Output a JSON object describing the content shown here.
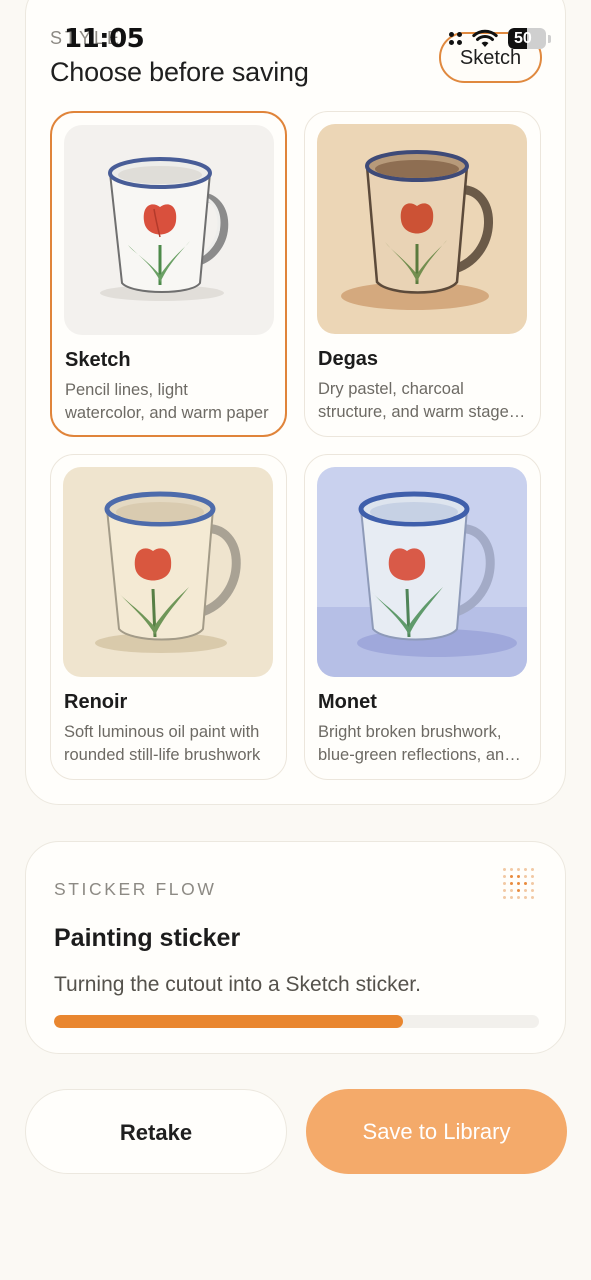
{
  "status_bar": {
    "time": "11:05",
    "battery": "50",
    "battery_fraction": 0.5
  },
  "chooser": {
    "eyebrow": "STYLE",
    "title": "Choose before saving",
    "selected_style": "Sketch",
    "styles": [
      {
        "name": "Sketch",
        "desc_line1": "Pencil lines, light",
        "desc_line2": "watercolor, and warm paper",
        "selected": true,
        "thumb": "sketch-mug-with-tulip"
      },
      {
        "name": "Degas",
        "desc_line1": "Dry pastel, charcoal",
        "desc_line2": "structure, and warm stage light",
        "selected": false,
        "thumb": "pastel-mug-with-tulip"
      },
      {
        "name": "Renoir",
        "desc_line1": "Soft luminous oil paint with",
        "desc_line2": "rounded still-life brushwork",
        "selected": false,
        "thumb": "oil-mug-with-tulip"
      },
      {
        "name": "Monet",
        "desc_line1": "Bright broken brushwork,",
        "desc_line2": "blue-green reflections, and light",
        "selected": false,
        "thumb": "impressionist-mug-with-tulip"
      }
    ]
  },
  "sticker_flow": {
    "eyebrow": "STICKER FLOW",
    "title": "Painting sticker",
    "status": "Turning the cutout into a Sketch sticker.",
    "progress": 0.72,
    "icon": "dot-grid-icon"
  },
  "actions": {
    "retake_label": "Retake",
    "save_label": "Save to Library"
  },
  "colors": {
    "accent": "#e0843a",
    "progress": "#e9862f",
    "save_button": "#f4aa6a",
    "background": "#fbf9f4"
  }
}
